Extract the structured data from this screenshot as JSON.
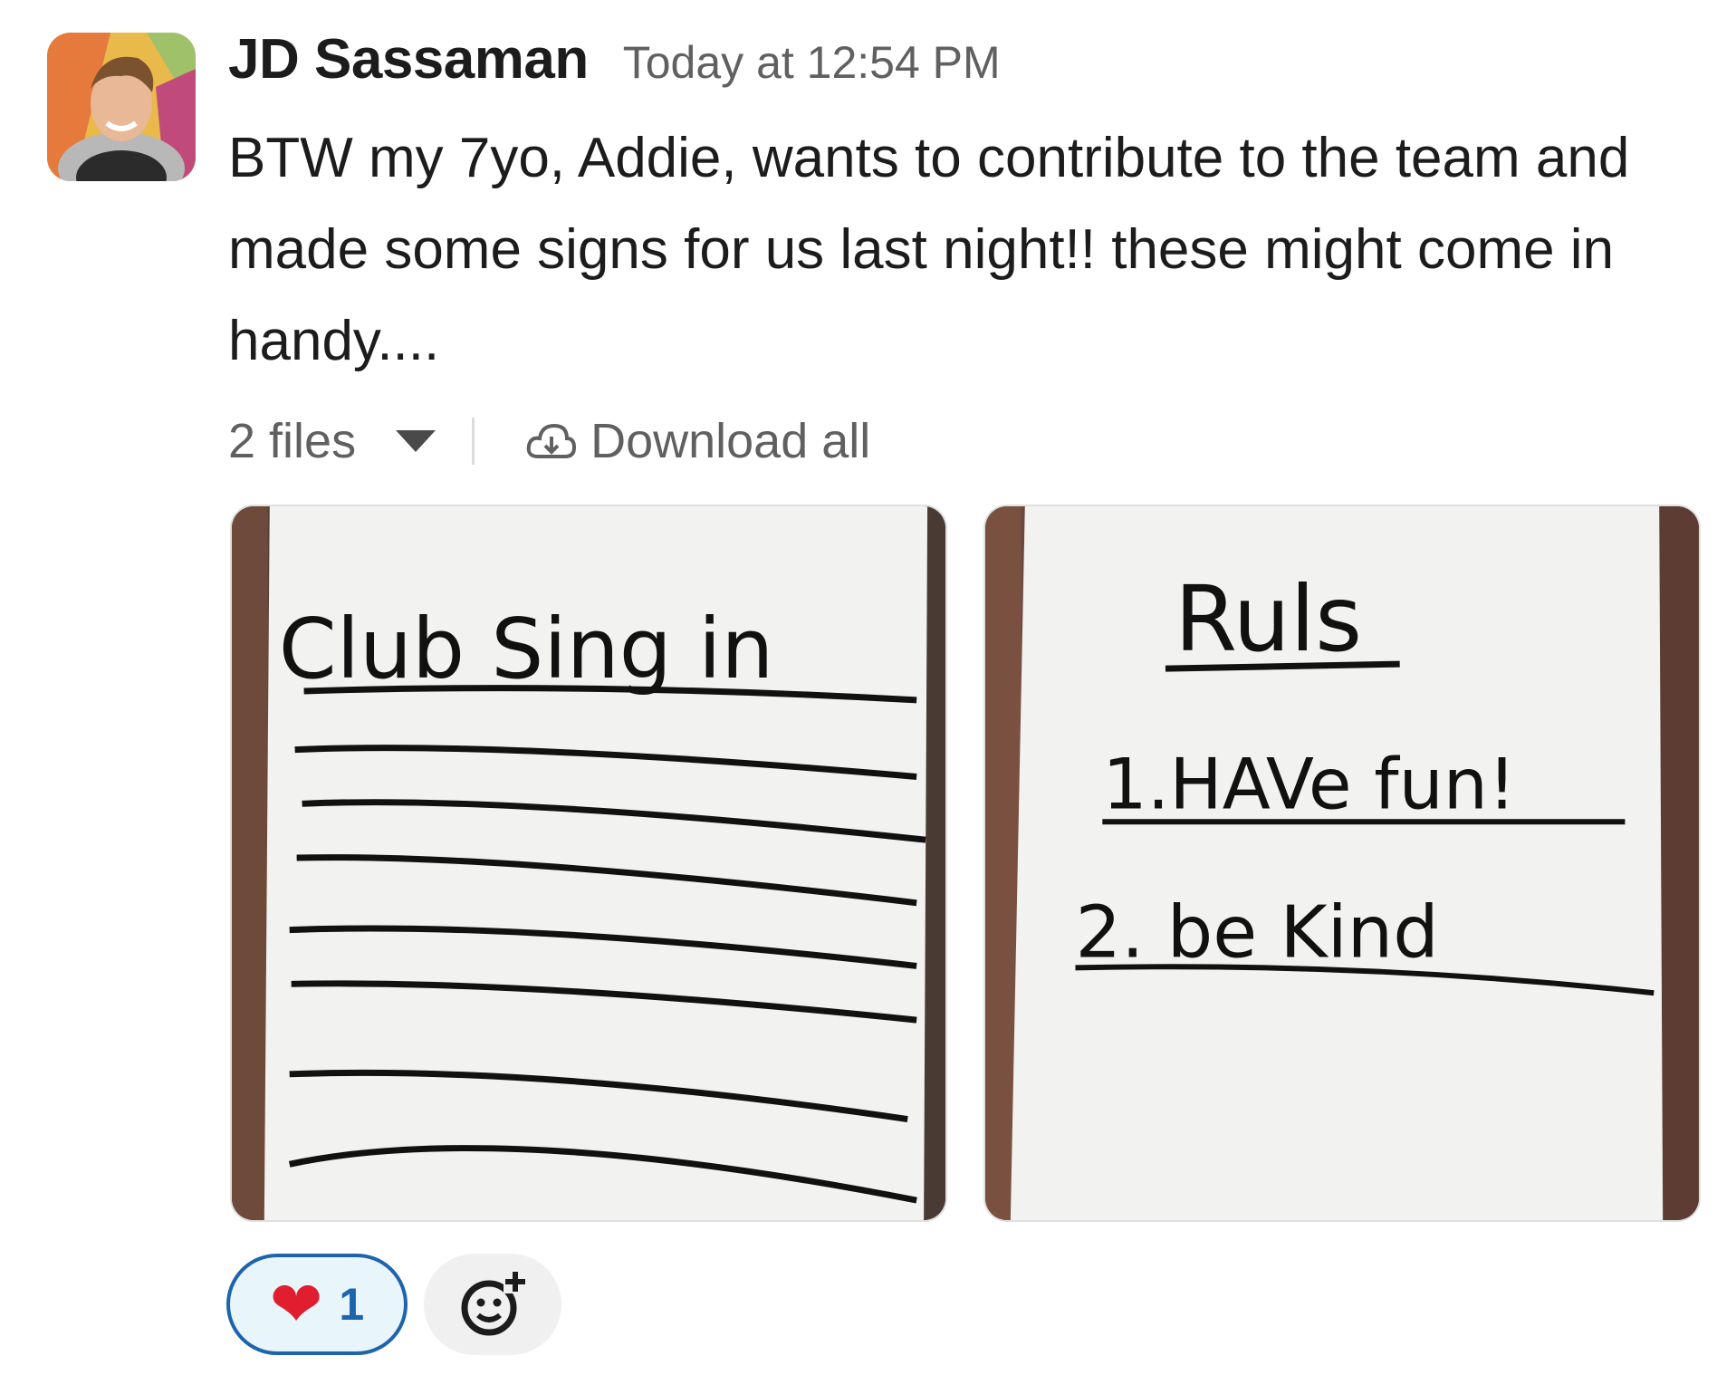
{
  "message": {
    "author": "JD Sassaman",
    "timestamp": "Today at 12:54 PM",
    "text": "BTW my 7yo, Addie, wants to contribute to the team and made some signs for us last night!!  these might come in handy....",
    "avatar_icon": "person-photo"
  },
  "files": {
    "count_label": "2 files",
    "download_label": "Download all",
    "images": [
      {
        "handwritten_title": "Club Sing in"
      },
      {
        "handwritten_title": "Ruls",
        "lines": [
          "1.HAVe fun!",
          "2. be Kind"
        ]
      }
    ]
  },
  "reactions": [
    {
      "emoji": "❤",
      "count": "1"
    }
  ],
  "colors": {
    "accent": "#1d64ae",
    "reaction_bg": "#e8f5fa",
    "muted_text": "#616061"
  }
}
